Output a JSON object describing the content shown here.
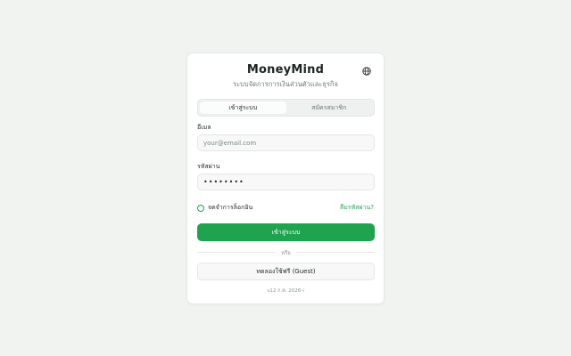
{
  "app": {
    "title": "MoneyMind",
    "subtitle": "ระบบจัดการการเงินส่วนตัวและธุรกิจ",
    "language_icon": "globe-icon"
  },
  "tabs": [
    {
      "label": "เข้าสู่ระบบ",
      "active": true
    },
    {
      "label": "สมัครสมาชิก",
      "active": false
    }
  ],
  "form": {
    "email_label": "อีเมล",
    "email_placeholder": "your@email.com",
    "password_label": "รหัสผ่าน",
    "password_value": "••••••••",
    "remember_label": "จดจำการล็อกอิน",
    "forgot_label": "ลืมรหัสผ่าน?",
    "submit_label": "เข้าสู่ระบบ",
    "divider_text": "หรือ",
    "guest_label": "ทดลองใช้ฟรี (Guest)"
  },
  "footer": {
    "version": "v12 ก.ค. 2026-i"
  },
  "colors": {
    "accent": "#1fa34e",
    "background": "#f1f3f1"
  }
}
